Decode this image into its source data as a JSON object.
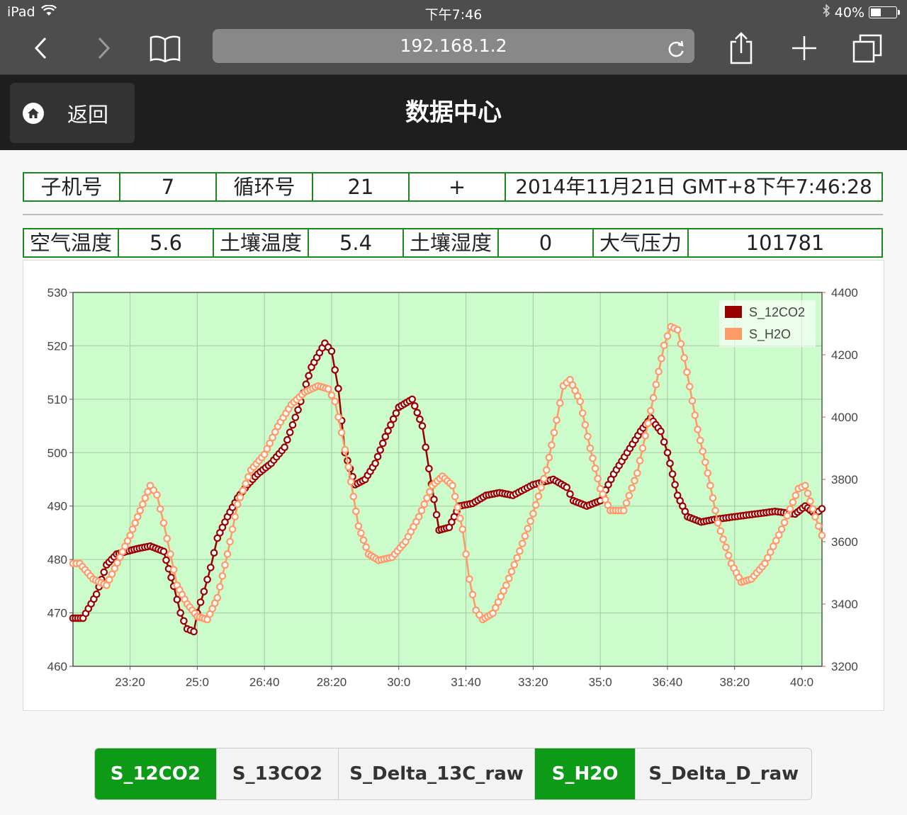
{
  "status_bar": {
    "device": "iPad",
    "time": "下午7:46",
    "battery": "40%",
    "battery_level": 0.4,
    "icons": [
      "wifi-icon",
      "bluetooth-icon",
      "battery-icon"
    ]
  },
  "browser": {
    "url": "192.168.1.2",
    "buttons": [
      "back-icon",
      "forward-icon",
      "bookmarks-icon",
      "reload-icon",
      "share-icon",
      "new-tab-icon",
      "tabs-icon"
    ]
  },
  "header": {
    "back_label": "返回",
    "title": "数据中心"
  },
  "info_row1": [
    "子机号",
    "7",
    "循环号",
    "21",
    "+",
    "2014年11月21日 GMT+8下午7:46:28"
  ],
  "info_row2": [
    "空气温度",
    "5.6",
    "土壤温度",
    "5.4",
    "土壤湿度",
    "0",
    "大气压力",
    "101781"
  ],
  "colors": {
    "plot_bg": "#ccfccc",
    "series1": "#990000",
    "series2": "#ff9966",
    "active_button": "#0d9a16",
    "table_border": "#1a8a1a"
  },
  "chart_data": {
    "type": "line",
    "x_ticks": [
      "23:20",
      "25:0",
      "26:40",
      "28:20",
      "30:0",
      "31:40",
      "33:20",
      "35:0",
      "36:40",
      "38:20",
      "40:0"
    ],
    "x_tick_minutes": [
      1400,
      1500,
      1600,
      1700,
      1800,
      1900,
      2000,
      2100,
      2200,
      2300,
      2400
    ],
    "xlim_minutes": [
      1315,
      2430
    ],
    "left_axis": {
      "ylim": [
        460,
        530
      ],
      "ticks": [
        460,
        470,
        480,
        490,
        500,
        510,
        520,
        530
      ]
    },
    "right_axis": {
      "ylim": [
        3200,
        4400
      ],
      "ticks": [
        3200,
        3400,
        3600,
        3800,
        4000,
        4200,
        4400
      ]
    },
    "grid": true,
    "legend": "top-right",
    "series": [
      {
        "name": "S_12CO2",
        "axis": "left",
        "x": [
          1315,
          1330,
          1350,
          1365,
          1380,
          1395,
          1410,
          1430,
          1450,
          1465,
          1475,
          1485,
          1495,
          1500,
          1510,
          1520,
          1530,
          1545,
          1560,
          1575,
          1590,
          1610,
          1630,
          1650,
          1670,
          1690,
          1700,
          1710,
          1720,
          1735,
          1750,
          1765,
          1780,
          1800,
          1820,
          1835,
          1845,
          1860,
          1875,
          1890,
          1910,
          1930,
          1950,
          1970,
          2000,
          2030,
          2050,
          2060,
          2080,
          2100,
          2120,
          2140,
          2160,
          2175,
          2190,
          2200,
          2215,
          2230,
          2250,
          2270,
          2300,
          2330,
          2360,
          2390,
          2405,
          2420,
          2430
        ],
        "y": [
          469,
          469,
          473.5,
          479,
          481,
          481.5,
          482,
          482.5,
          481.5,
          475,
          470,
          467,
          466.5,
          470,
          474,
          478.5,
          484,
          488,
          491.5,
          494,
          496,
          498,
          501,
          508,
          516,
          520.5,
          519,
          512,
          500,
          494,
          495,
          498,
          503,
          508.5,
          510,
          505,
          497,
          485.5,
          486,
          490,
          490.5,
          492,
          492.5,
          492,
          494,
          495,
          493.5,
          491,
          490,
          491,
          496,
          500,
          504,
          506.5,
          504,
          500,
          492,
          488,
          487,
          487.5,
          488,
          488.5,
          489,
          488.5,
          490,
          488.5,
          489.5
        ]
      },
      {
        "name": "S_H2O",
        "axis": "right",
        "x": [
          1315,
          1325,
          1345,
          1365,
          1385,
          1400,
          1415,
          1430,
          1440,
          1450,
          1460,
          1470,
          1485,
          1500,
          1515,
          1530,
          1545,
          1560,
          1580,
          1600,
          1620,
          1640,
          1660,
          1680,
          1695,
          1705,
          1715,
          1725,
          1740,
          1755,
          1770,
          1790,
          1810,
          1830,
          1850,
          1865,
          1880,
          1895,
          1905,
          1915,
          1925,
          1940,
          1960,
          1980,
          2000,
          2020,
          2035,
          2045,
          2055,
          2070,
          2085,
          2100,
          2115,
          2135,
          2155,
          2175,
          2195,
          2205,
          2215,
          2225,
          2245,
          2260,
          2275,
          2295,
          2310,
          2325,
          2345,
          2370,
          2395,
          2405,
          2420,
          2430
        ],
        "y": [
          3530,
          3530,
          3480,
          3460,
          3550,
          3620,
          3700,
          3780,
          3750,
          3660,
          3560,
          3460,
          3400,
          3360,
          3350,
          3420,
          3560,
          3720,
          3830,
          3880,
          3970,
          4040,
          4080,
          4100,
          4090,
          4050,
          3950,
          3840,
          3650,
          3560,
          3540,
          3550,
          3600,
          3680,
          3780,
          3810,
          3780,
          3640,
          3480,
          3380,
          3350,
          3370,
          3460,
          3570,
          3690,
          3830,
          3990,
          4100,
          4120,
          4050,
          3900,
          3770,
          3700,
          3700,
          3820,
          4020,
          4230,
          4290,
          4280,
          4190,
          3960,
          3820,
          3660,
          3530,
          3470,
          3480,
          3530,
          3640,
          3770,
          3780,
          3680,
          3620
        ]
      }
    ]
  },
  "buttons": [
    {
      "label": "S_12CO2",
      "active": true
    },
    {
      "label": "S_13CO2",
      "active": false
    },
    {
      "label": "S_Delta_13C_raw",
      "active": false
    },
    {
      "label": "S_H2O",
      "active": true
    },
    {
      "label": "S_Delta_D_raw",
      "active": false
    }
  ]
}
